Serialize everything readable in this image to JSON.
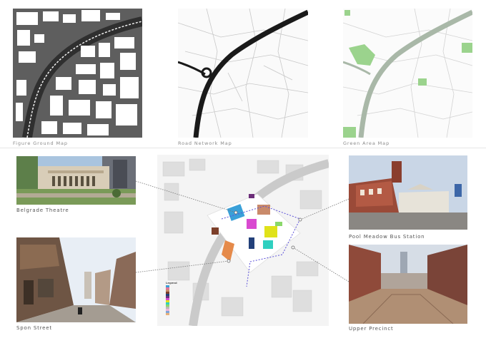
{
  "maps": {
    "figure_ground": {
      "caption": "Figure Ground Map"
    },
    "road_network": {
      "caption": "Road Network Map"
    },
    "green_area": {
      "caption": "Green Area Map"
    }
  },
  "photos": {
    "belgrade": {
      "caption": "Belgrade Theatre"
    },
    "spon": {
      "caption": "Spon Street"
    },
    "pool_meadow": {
      "caption": "Pool Meadow Bus Station"
    },
    "upper_precinct": {
      "caption": "Upper Precinct"
    }
  },
  "site_plan": {
    "legend_title": "Legend",
    "legend_items": [
      {
        "label": "",
        "color": "#3aa0d8"
      },
      {
        "label": "",
        "color": "#e2739a"
      },
      {
        "label": "",
        "color": "#c98a6a"
      },
      {
        "label": "",
        "color": "#7c3f2a"
      },
      {
        "label": "",
        "color": "#23407a"
      },
      {
        "label": "",
        "color": "#6d2f7a"
      },
      {
        "label": "",
        "color": "#d94ad0"
      },
      {
        "label": "",
        "color": "#e0e21a"
      },
      {
        "label": "",
        "color": "#2fd0c0"
      },
      {
        "label": "",
        "color": "#8ad86a"
      },
      {
        "label": "",
        "color": "#b8b8b8"
      },
      {
        "label": "",
        "color": "#f2b6d8"
      },
      {
        "label": "",
        "color": "#7fa6d9"
      },
      {
        "label": "",
        "color": "#e8b07a"
      }
    ]
  },
  "colors": {
    "building_dark": "#555555",
    "road_black": "#1a1a1a",
    "green_fill": "#9bd38d",
    "road_grey": "#a9b8a8",
    "route_purple": "#5a4fd8"
  }
}
